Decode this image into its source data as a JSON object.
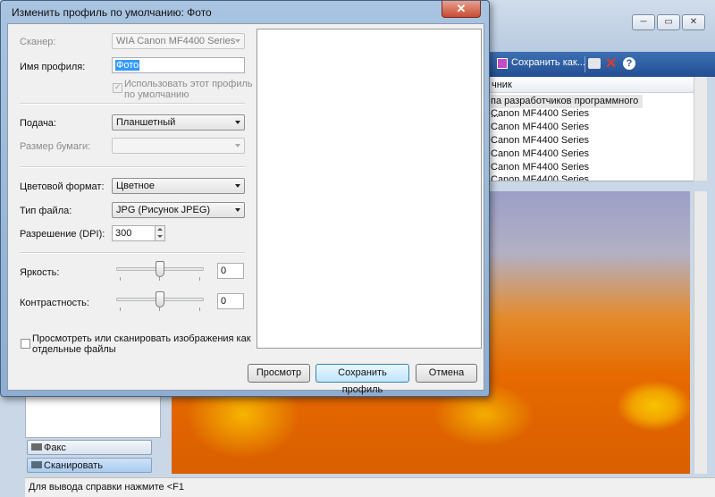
{
  "background_app": {
    "title_fragment": "",
    "toolbar": {
      "save_as_label": "Сохранить как..."
    },
    "list": {
      "column_header": "чник",
      "rows": [
        "па разработчиков программного ...",
        "Canon MF4400 Series",
        "Canon MF4400 Series",
        "Canon MF4400 Series",
        "Canon MF4400 Series",
        "Canon MF4400 Series",
        "Canon MF4400 Series"
      ]
    },
    "sidebar": {
      "fax_label": "Факс",
      "scan_label": "Сканировать"
    },
    "status_text": "Для вывода справки нажмите <F1"
  },
  "dialog": {
    "title": "Изменить профиль по умолчанию: Фото",
    "close_glyph": "✕",
    "scanner": {
      "label": "Сканер:",
      "value": "WIA Canon MF4400 Series"
    },
    "profile_name": {
      "label": "Имя профиля:",
      "value": "Фото"
    },
    "use_default": {
      "label_line1": "Использовать этот профиль",
      "label_line2": "по умолчанию",
      "checked": true
    },
    "source": {
      "label": "Подача:",
      "value": "Планшетный"
    },
    "paper_size": {
      "label": "Размер бумаги:",
      "value": ""
    },
    "color_format": {
      "label": "Цветовой формат:",
      "value": "Цветное"
    },
    "file_type": {
      "label": "Тип файла:",
      "value": "JPG (Рисунок JPEG)"
    },
    "resolution": {
      "label": "Разрешение (DPI):",
      "value": "300"
    },
    "brightness": {
      "label": "Яркость:",
      "value": "0",
      "level_percent": 50
    },
    "contrast": {
      "label": "Контрастность:",
      "value": "0",
      "level_percent": 50
    },
    "separate_files": {
      "label_line1": "Просмотреть или сканировать изображения как",
      "label_line2": "отдельные файлы",
      "checked": false
    },
    "buttons": {
      "preview": "Просмотр",
      "save_profile": "Сохранить профиль",
      "cancel": "Отмена"
    }
  },
  "colors": {
    "dialog_frame": "#a9c4e0",
    "toolbar_blue": "#2f5fa3",
    "close_button": "#c84b33",
    "selection": "#3399ff"
  }
}
